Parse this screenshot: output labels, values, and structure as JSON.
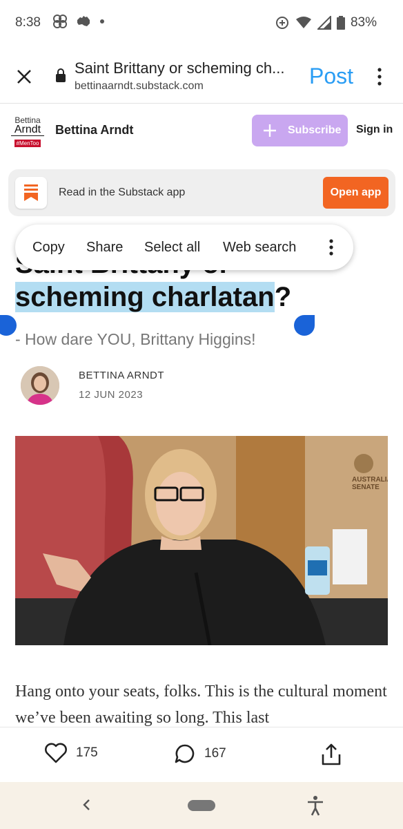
{
  "status_bar": {
    "time": "8:38",
    "battery": "83%",
    "icons": [
      "pinwheel-icon",
      "australia-map-icon",
      "dot-icon",
      "data-saver-icon",
      "wifi-icon",
      "signal-icon",
      "battery-icon"
    ]
  },
  "browser": {
    "page_title": "Saint Brittany or scheming ch...",
    "domain": "bettinaarndt.substack.com",
    "post_label": "Post",
    "accent_color": "#2a9df4"
  },
  "publication": {
    "logo_line1": "Bettina",
    "logo_line2": "Arndt",
    "logo_tag": "#MenToo",
    "name": "Bettina Arndt",
    "subscribe_label": "Subscribe",
    "signin_label": "Sign in",
    "subscribe_color": "#c9a7f0"
  },
  "app_banner": {
    "text": "Read in the Substack app",
    "button_label": "Open app",
    "button_color": "#f26522"
  },
  "context_menu": {
    "items": [
      "Copy",
      "Share",
      "Select all",
      "Web search"
    ]
  },
  "article": {
    "title_line1_partial": "Saint Brittany or",
    "title_selected": "scheming charlatan",
    "title_suffix": "?",
    "subtitle": "- How dare YOU, Brittany Higgins!",
    "author": "BETTINA ARNDT",
    "date": "12 JUN 2023",
    "body": "Hang onto your seats, folks. This is the cultural moment we’ve been awaiting so long. This last",
    "image_caption_visible": "AUSTRALIA SENATE"
  },
  "actions": {
    "likes": "175",
    "comments": "167"
  }
}
